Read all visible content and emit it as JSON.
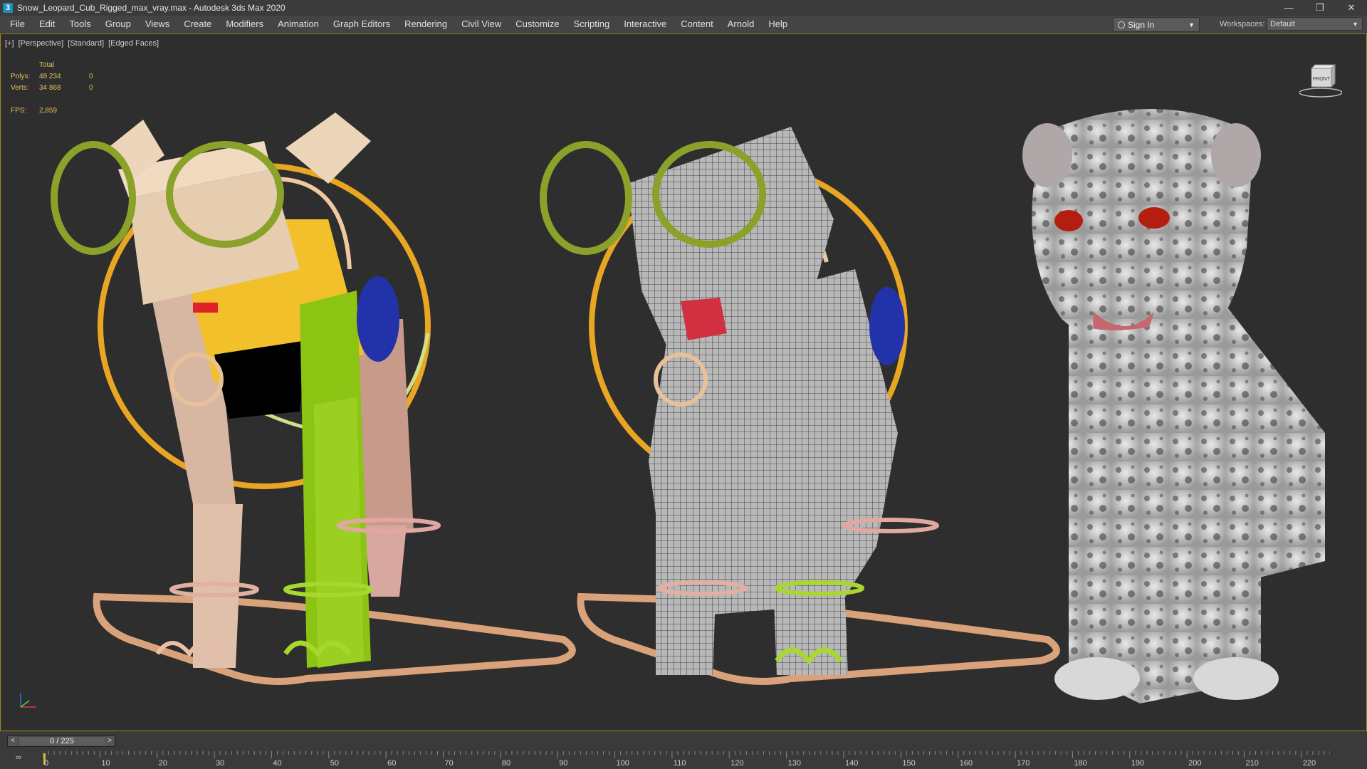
{
  "window": {
    "title": "Snow_Leopard_Cub_Rigged_max_vray.max - Autodesk 3ds Max 2020",
    "icon_name": "3dsmax-icon",
    "controls": [
      "minimize-icon",
      "restore-icon",
      "close-icon"
    ]
  },
  "menu": {
    "items": [
      "File",
      "Edit",
      "Tools",
      "Group",
      "Views",
      "Create",
      "Modifiers",
      "Animation",
      "Graph Editors",
      "Rendering",
      "Civil View",
      "Customize",
      "Scripting",
      "Interactive",
      "Content",
      "Arnold",
      "Help"
    ],
    "sign_in": "Sign In",
    "workspaces_label": "Workspaces:",
    "workspace_value": "Default"
  },
  "viewport": {
    "labels": [
      "[+]",
      "[Perspective]",
      "[Standard]",
      "[Edged Faces]"
    ],
    "stats": {
      "header": "Total",
      "polys_label": "Polys:",
      "polys_value": "48 234",
      "polys_sel": "0",
      "verts_label": "Verts:",
      "verts_value": "34 868",
      "verts_sel": "0",
      "fps_label": "FPS:",
      "fps_value": "2,859"
    },
    "viewcube_label": "FRONT",
    "colors": {
      "accent_border": "#a08a2a",
      "stats_text": "#e2c15a"
    }
  },
  "timeline": {
    "frame_display": "0 / 225",
    "prev": "<",
    "next": ">",
    "ticks": [
      "0",
      "10",
      "20",
      "30",
      "40",
      "50",
      "60",
      "70",
      "80",
      "90",
      "100",
      "110",
      "120",
      "130",
      "140",
      "150",
      "160",
      "170",
      "180",
      "190",
      "200",
      "210",
      "220"
    ]
  }
}
